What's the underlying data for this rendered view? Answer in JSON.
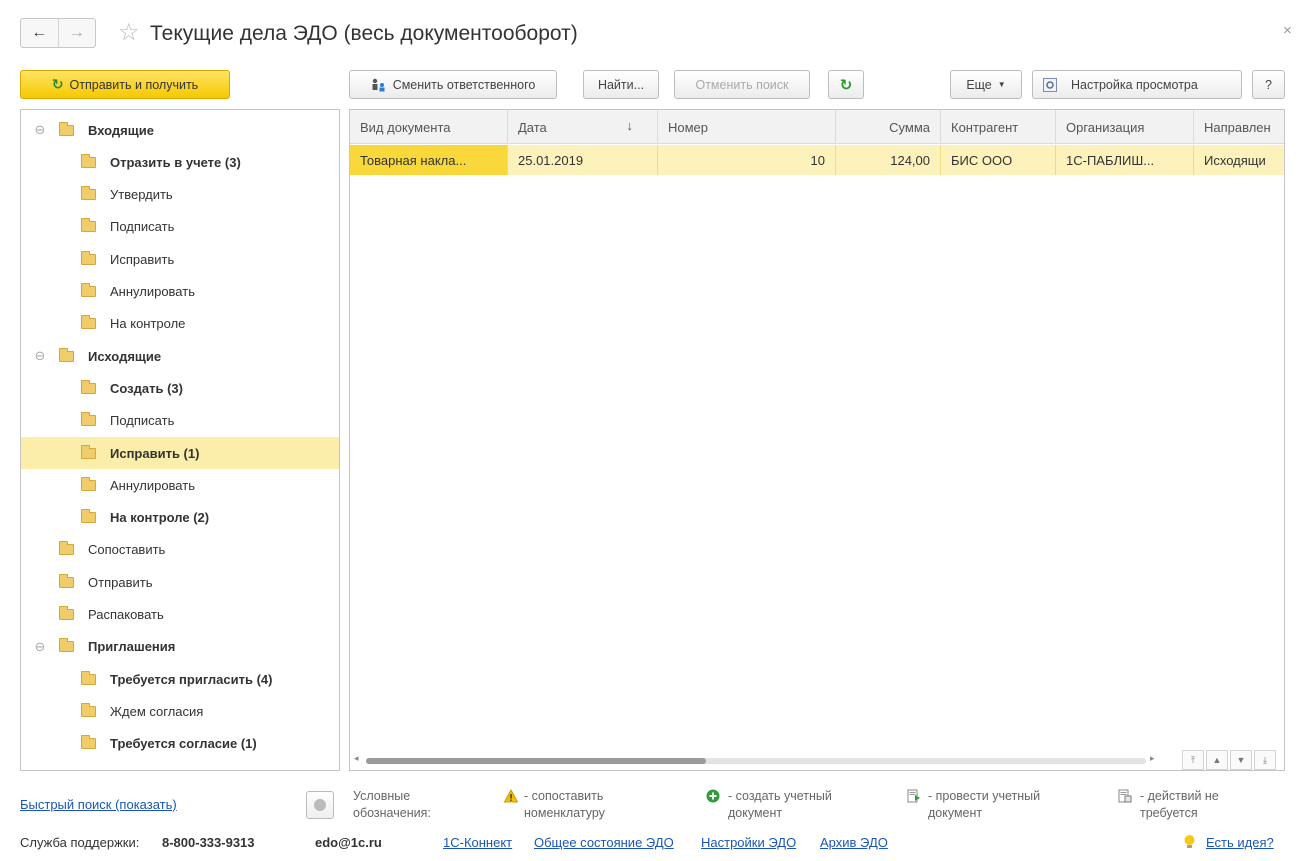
{
  "window": {
    "title": "Текущие дела ЭДО (весь документооборот)",
    "close": "×"
  },
  "nav": {
    "back": "←",
    "forward": "→"
  },
  "toolbar": {
    "send_receive": "Отправить и получить",
    "change_responsible": "Сменить ответственного",
    "find": "Найти...",
    "cancel_search": "Отменить поиск",
    "more": "Еще",
    "view_settings": "Настройка просмотра",
    "help": "?"
  },
  "tree": [
    {
      "label": "Входящие",
      "level": 0,
      "bold": true,
      "collapsible": true
    },
    {
      "label": "Отразить в учете (3)",
      "level": 1,
      "bold": true
    },
    {
      "label": "Утвердить",
      "level": 1,
      "bold": false
    },
    {
      "label": "Подписать",
      "level": 1,
      "bold": false
    },
    {
      "label": "Исправить",
      "level": 1,
      "bold": false
    },
    {
      "label": "Аннулировать",
      "level": 1,
      "bold": false
    },
    {
      "label": "На контроле",
      "level": 1,
      "bold": false
    },
    {
      "label": "Исходящие",
      "level": 0,
      "bold": true,
      "collapsible": true
    },
    {
      "label": "Создать (3)",
      "level": 1,
      "bold": true
    },
    {
      "label": "Подписать",
      "level": 1,
      "bold": false
    },
    {
      "label": "Исправить (1)",
      "level": 1,
      "bold": true,
      "selected": true
    },
    {
      "label": "Аннулировать",
      "level": 1,
      "bold": false
    },
    {
      "label": "На контроле (2)",
      "level": 1,
      "bold": true
    },
    {
      "label": "Сопоставить",
      "level": 0,
      "bold": false
    },
    {
      "label": "Отправить",
      "level": 0,
      "bold": false
    },
    {
      "label": "Распаковать",
      "level": 0,
      "bold": false
    },
    {
      "label": "Приглашения",
      "level": 0,
      "bold": true,
      "collapsible": true
    },
    {
      "label": "Требуется пригласить (4)",
      "level": 1,
      "bold": true
    },
    {
      "label": "Ждем согласия",
      "level": 1,
      "bold": false
    },
    {
      "label": "Требуется согласие (1)",
      "level": 1,
      "bold": true
    }
  ],
  "table": {
    "columns": [
      "Вид документа",
      "Дата",
      "Номер",
      "Сумма",
      "Контрагент",
      "Организация",
      "Направлен"
    ],
    "sort_indicator": "↓",
    "rows": [
      [
        "Товарная накла...",
        "25.01.2019",
        "10",
        "124,00",
        "БИС ООО",
        "1С-ПАБЛИШ...",
        "Исходящи"
      ]
    ]
  },
  "quick_search": "Быстрый поиск (показать)",
  "legend": {
    "title": "Условные обозначения:",
    "items": [
      {
        "icon": "warning-icon",
        "text": "- сопоставить номенклатуру"
      },
      {
        "icon": "plus-circle-icon",
        "text": "- создать учетный документ"
      },
      {
        "icon": "post-document-icon",
        "text": "- провести учетный документ"
      },
      {
        "icon": "no-action-icon",
        "text": "- действий не требуется"
      }
    ]
  },
  "footer": {
    "support_label": "Служба поддержки:",
    "phone": "8-800-333-9313",
    "email": "edo@1c.ru",
    "links": [
      "1С-Коннект",
      "Общее состояние ЭДО",
      "Настройки ЭДО",
      "Архив ЭДО"
    ],
    "idea": "Есть идея?"
  },
  "colors": {
    "accent": "#f8d83a",
    "selection": "#fbeeaa",
    "link": "#1b56b5"
  }
}
